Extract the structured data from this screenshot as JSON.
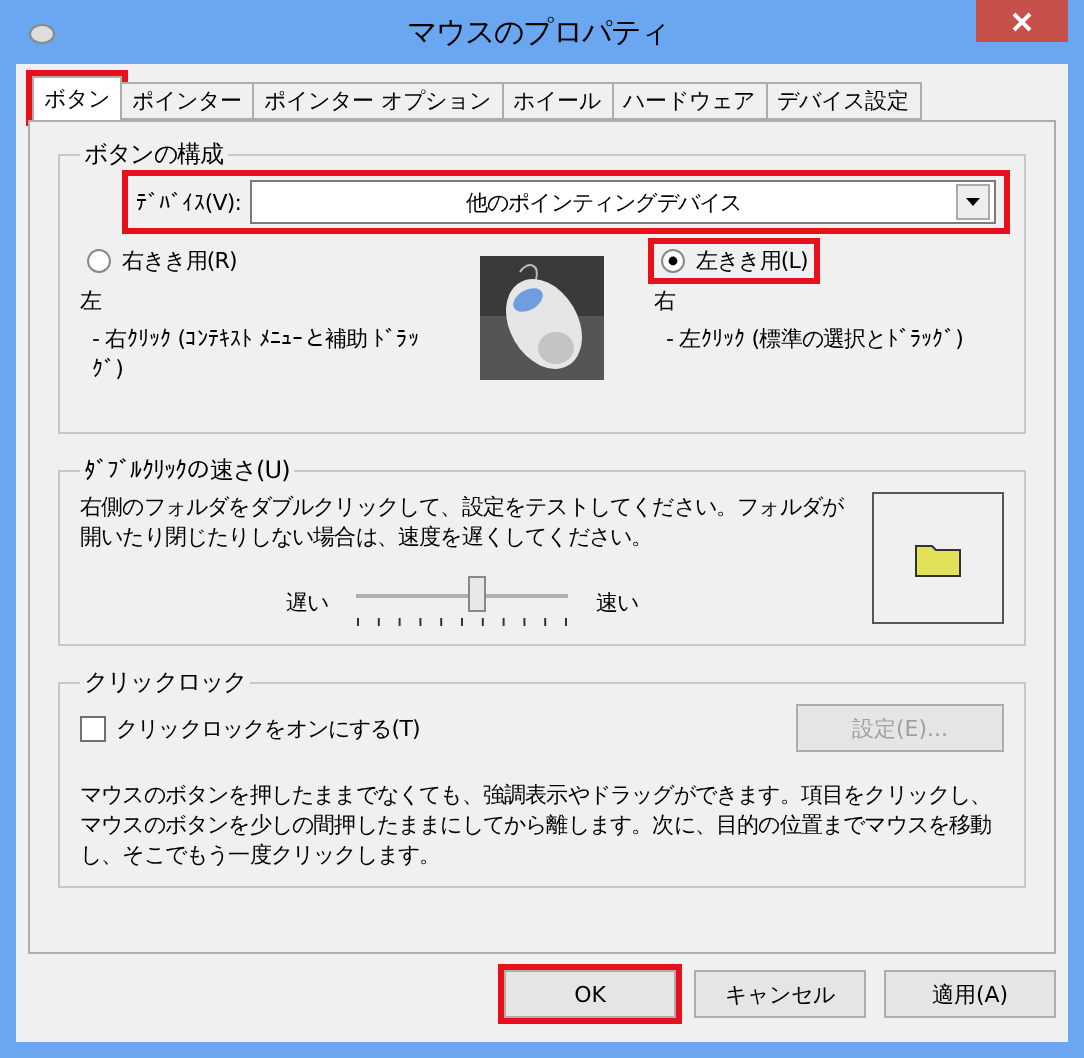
{
  "window": {
    "title": "マウスのプロパティ"
  },
  "tabs": [
    {
      "label": "ボタン",
      "selected": true,
      "highlighted": true
    },
    {
      "label": "ポインター",
      "selected": false,
      "highlighted": false
    },
    {
      "label": "ポインター オプション",
      "selected": false,
      "highlighted": false
    },
    {
      "label": "ホイール",
      "selected": false,
      "highlighted": false
    },
    {
      "label": "ハードウェア",
      "selected": false,
      "highlighted": false
    },
    {
      "label": "デバイス設定",
      "selected": false,
      "highlighted": false
    }
  ],
  "button_config": {
    "title": "ボタンの構成",
    "device": {
      "label": "ﾃﾞﾊﾞｲｽ(V):",
      "value": "他のポインティングデバイス",
      "highlighted": true
    },
    "options": [
      {
        "label": "右きき用(R)",
        "selected": false,
        "highlighted": false,
        "heading": "左",
        "description": "- 右ｸﾘｯｸ (ｺﾝﾃｷｽﾄ ﾒﾆｭｰと補助 ﾄﾞﾗｯｸﾞ)"
      },
      {
        "label": "左きき用(L)",
        "selected": true,
        "highlighted": true,
        "heading": "右",
        "description": "- 左ｸﾘｯｸ (標準の選択とﾄﾞﾗｯｸﾞ)"
      }
    ]
  },
  "double_click": {
    "title": "ﾀﾞﾌﾞﾙｸﾘｯｸの速さ(U)",
    "description": "右側のフォルダをダブルクリックして、設定をテストしてください。フォルダが開いたり閉じたりしない場合は、速度を遅くしてください。",
    "slow_label": "遅い",
    "fast_label": "速い",
    "level": 0.57
  },
  "click_lock": {
    "title": "クリックロック",
    "checkbox": {
      "label": "クリックロックをオンにする(T)",
      "checked": false
    },
    "settings_button": {
      "label": "設定(E)...",
      "disabled": true
    },
    "description": "マウスのボタンを押したままでなくても、強調表示やドラッグができます。項目をクリックし、マウスのボタンを少しの間押したままにしてから離します。次に、目的の位置までマウスを移動し、そこでもう一度クリックします。"
  },
  "buttons": [
    {
      "label": "OK",
      "highlighted": true
    },
    {
      "label": "キャンセル",
      "highlighted": false
    },
    {
      "label": "適用(A)",
      "highlighted": false
    }
  ]
}
